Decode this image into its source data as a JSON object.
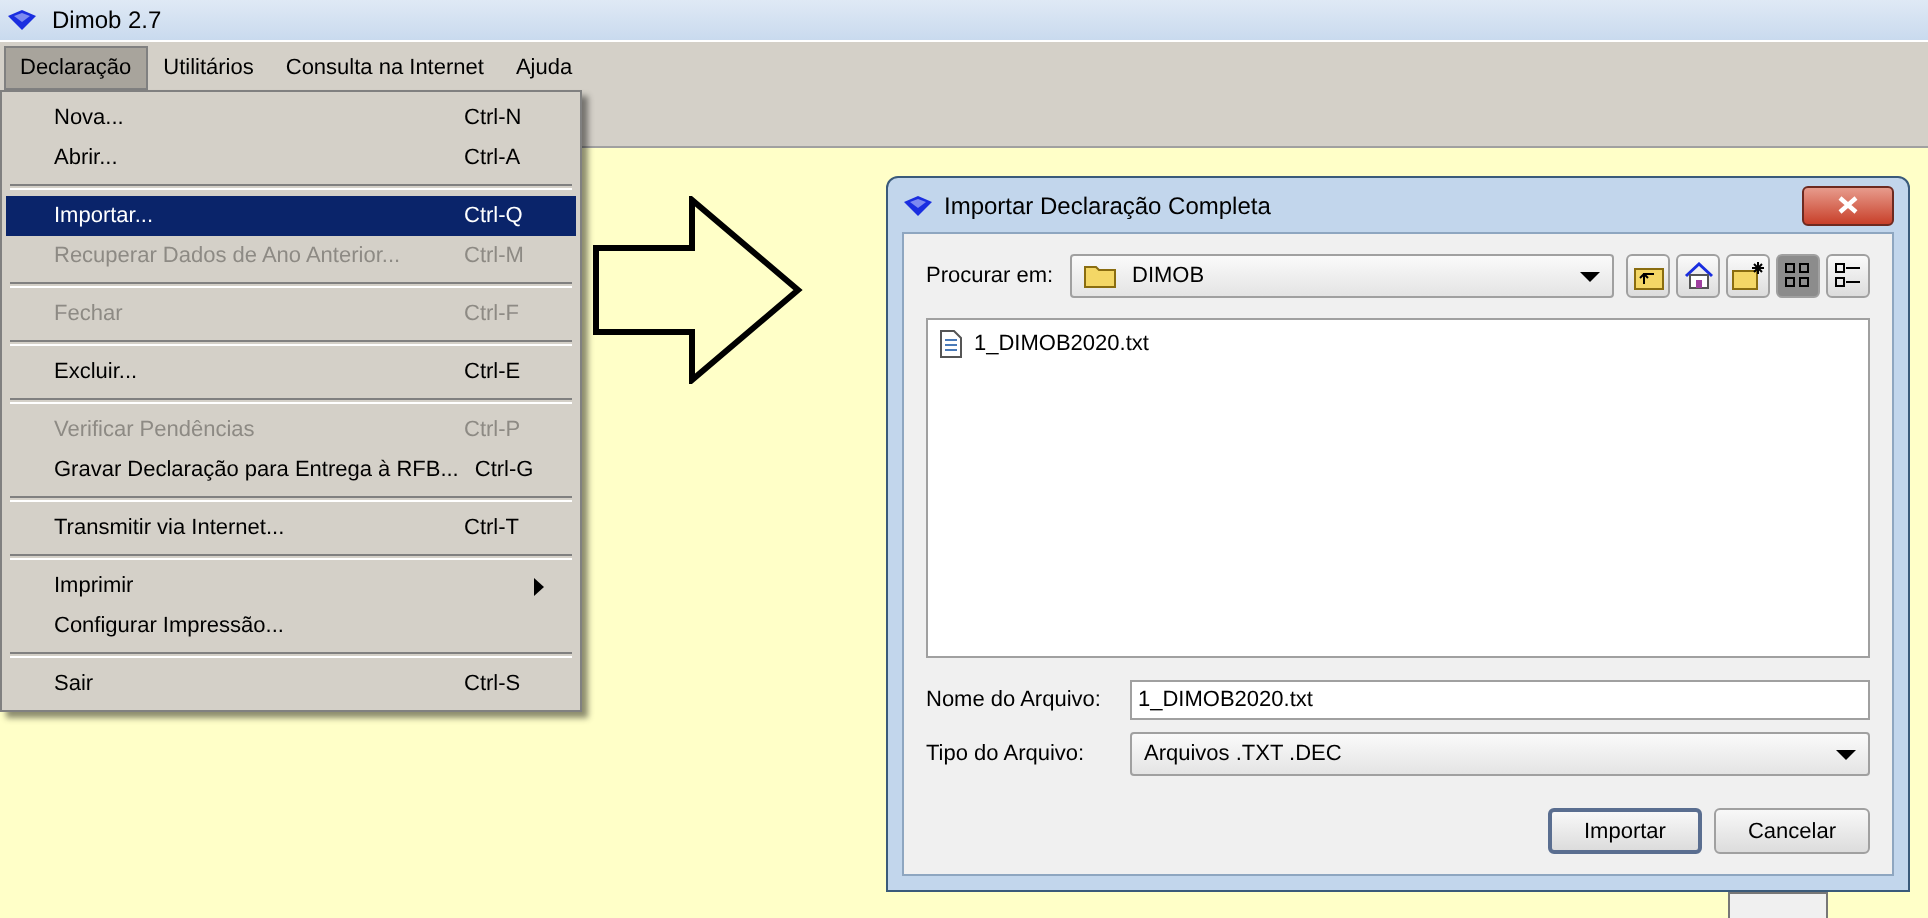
{
  "window": {
    "title": "Dimob 2.7"
  },
  "menubar": [
    {
      "label": "Declaração",
      "selected": true
    },
    {
      "label": "Utilitários",
      "selected": false
    },
    {
      "label": "Consulta na Internet",
      "selected": false
    },
    {
      "label": "Ajuda",
      "selected": false
    }
  ],
  "menu": {
    "items": [
      {
        "kind": "item",
        "label": "Nova...",
        "shortcut": "Ctrl-N",
        "disabled": false,
        "selected": false
      },
      {
        "kind": "item",
        "label": "Abrir...",
        "shortcut": "Ctrl-A",
        "disabled": false,
        "selected": false
      },
      {
        "kind": "separator"
      },
      {
        "kind": "item",
        "label": "Importar...",
        "shortcut": "Ctrl-Q",
        "disabled": false,
        "selected": true
      },
      {
        "kind": "item",
        "label": "Recuperar Dados de Ano Anterior...",
        "shortcut": "Ctrl-M",
        "disabled": true,
        "selected": false
      },
      {
        "kind": "separator"
      },
      {
        "kind": "item",
        "label": "Fechar",
        "shortcut": "Ctrl-F",
        "disabled": true,
        "selected": false
      },
      {
        "kind": "separator"
      },
      {
        "kind": "item",
        "label": "Excluir...",
        "shortcut": "Ctrl-E",
        "disabled": false,
        "selected": false
      },
      {
        "kind": "separator"
      },
      {
        "kind": "item",
        "label": "Verificar Pendências",
        "shortcut": "Ctrl-P",
        "disabled": true,
        "selected": false
      },
      {
        "kind": "item",
        "label": "Gravar Declaração para Entrega à RFB...",
        "shortcut": "Ctrl-G",
        "disabled": false,
        "selected": false
      },
      {
        "kind": "separator"
      },
      {
        "kind": "item",
        "label": "Transmitir via Internet...",
        "shortcut": "Ctrl-T",
        "disabled": false,
        "selected": false
      },
      {
        "kind": "separator"
      },
      {
        "kind": "submenu",
        "label": "Imprimir",
        "disabled": false,
        "selected": false
      },
      {
        "kind": "item",
        "label": "Configurar Impressão...",
        "disabled": false,
        "selected": false
      },
      {
        "kind": "separator"
      },
      {
        "kind": "item",
        "label": "Sair",
        "shortcut": "Ctrl-S",
        "disabled": false,
        "selected": false
      }
    ]
  },
  "dialog": {
    "title": "Importar Declaração Completa",
    "look_in": {
      "label": "Procurar em:",
      "value": "DIMOB"
    },
    "view_buttons": [
      {
        "kind": "up",
        "selected": false
      },
      {
        "kind": "home",
        "selected": false
      },
      {
        "kind": "new-folder",
        "selected": false
      },
      {
        "kind": "list",
        "selected": true
      },
      {
        "kind": "details",
        "selected": false
      }
    ],
    "files": [
      {
        "name": "1_DIMOB2020.txt",
        "selected": false
      }
    ],
    "file_name": {
      "label": "Nome do Arquivo:",
      "value": "1_DIMOB2020.txt"
    },
    "file_type": {
      "label": "Tipo do Arquivo:",
      "value": "Arquivos .TXT .DEC"
    },
    "buttons": [
      {
        "label": "Importar",
        "default": true
      },
      {
        "label": "Cancelar",
        "default": false
      }
    ]
  }
}
